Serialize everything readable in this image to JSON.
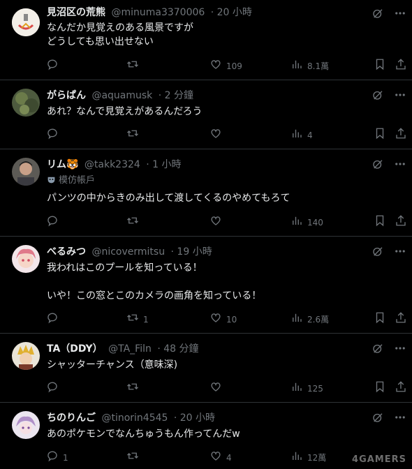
{
  "tweets": [
    {
      "name": "見沼区の荒熊",
      "handle": "@minuma3370006",
      "time": "· 20 小時",
      "text": "なんだか見覚えのある風景ですが\nどうしても思い出せない",
      "reply": "",
      "retweet": "",
      "like": "109",
      "views": "8.1萬"
    },
    {
      "name": "がらぱん",
      "handle": "@aquamusk",
      "time": "· 2 分鐘",
      "text": "あれ？なんで見覚えがあるんだろう",
      "reply": "",
      "retweet": "",
      "like": "",
      "views": "4"
    },
    {
      "name": "リム🐯",
      "handle": "@takk2324",
      "time": "· 1 小時",
      "badge": "模仿帳戶",
      "text": "パンツの中からきのみ出して渡してくるのやめてもろて",
      "reply": "",
      "retweet": "",
      "like": "",
      "views": "140"
    },
    {
      "name": "べるみつ",
      "handle": "@nicovermitsu",
      "time": "· 19 小時",
      "text": "我われはこのプールを知っている！\n\nいや！この窓とこのカメラの画角を知っている！",
      "reply": "",
      "retweet": "1",
      "like": "10",
      "views": "2.6萬"
    },
    {
      "name": "TA（DDY）",
      "handle": "@TA_Filn",
      "time": "· 48 分鐘",
      "text": "シャッターチャンス（意味深)",
      "reply": "",
      "retweet": "",
      "like": "",
      "views": "125"
    },
    {
      "name": "ちのりんご",
      "handle": "@tinorin4545",
      "time": "· 20 小時",
      "text": "あのポケモンでなんちゅうもん作ってんだw",
      "reply": "1",
      "retweet": "",
      "like": "4",
      "views": "12萬"
    }
  ],
  "watermark": "4GAMERS",
  "icons": [
    "reply-icon",
    "retweet-icon",
    "like-icon",
    "views-icon",
    "bookmark-icon",
    "share-icon",
    "grok-icon",
    "more-icon",
    "mask-icon"
  ],
  "colors": {
    "background": "#000000",
    "text": "#e7e9ea",
    "muted": "#71767b",
    "divider": "#2f3336"
  }
}
